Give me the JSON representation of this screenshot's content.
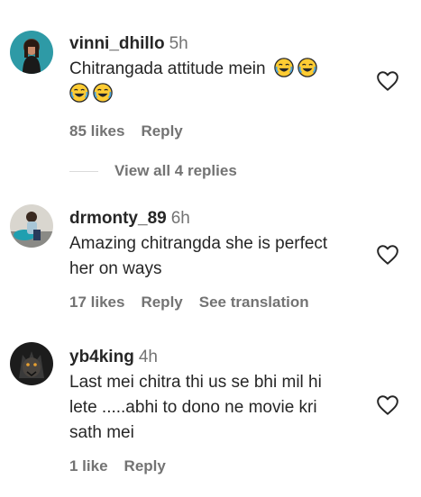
{
  "comments": [
    {
      "username": "vinni_dhillo",
      "time": "5h",
      "text_line1": "Chitrangada attitude mein",
      "likes": "85 likes",
      "reply": "Reply"
    },
    {
      "username": "drmonty_89",
      "time": "6h",
      "text_line1": "Amazing chitrangda she is perfect",
      "text_line2": "her on ways",
      "likes": "17 likes",
      "reply": "Reply",
      "translate": "See translation"
    },
    {
      "username": "yb4king",
      "time": "4h",
      "text_line1": "Last mei chitra thi us se bhi mil hi",
      "text_line2": "lete .....abhi to dono ne movie kri",
      "text_line3": "sath mei",
      "likes": "1 like",
      "reply": "Reply"
    }
  ],
  "view_replies": "View all 4 replies",
  "icons": {
    "laugh_emoji": "face-with-tears-of-joy-icon",
    "heart": "heart-outline-icon"
  },
  "colors": {
    "text": "#262626",
    "secondary": "#737373",
    "background": "#ffffff"
  }
}
